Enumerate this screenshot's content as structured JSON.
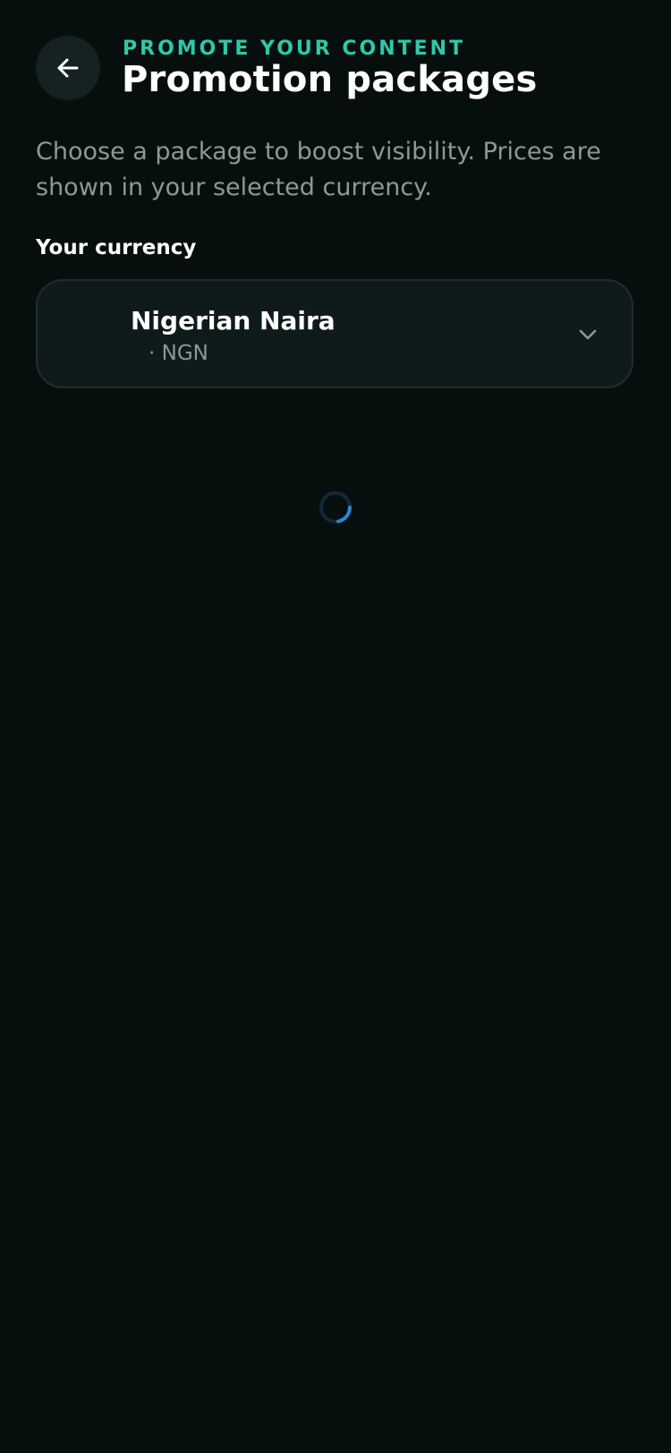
{
  "header": {
    "eyebrow": "PROMOTE YOUR CONTENT",
    "title": "Promotion packages",
    "back_icon": "arrow-left-icon"
  },
  "intro": {
    "text": "Choose a package to boost visibility. Prices are shown in your selected currency."
  },
  "currency": {
    "label": "Your currency",
    "selected_name": "Nigerian Naira",
    "selected_code": "· NGN",
    "dropdown_icon": "chevron-down-icon"
  },
  "loading": {
    "icon": "loading-spinner-icon"
  },
  "colors": {
    "background": "#070f0e",
    "accent": "#2fc8a9",
    "spinner": "#2e82d6"
  }
}
